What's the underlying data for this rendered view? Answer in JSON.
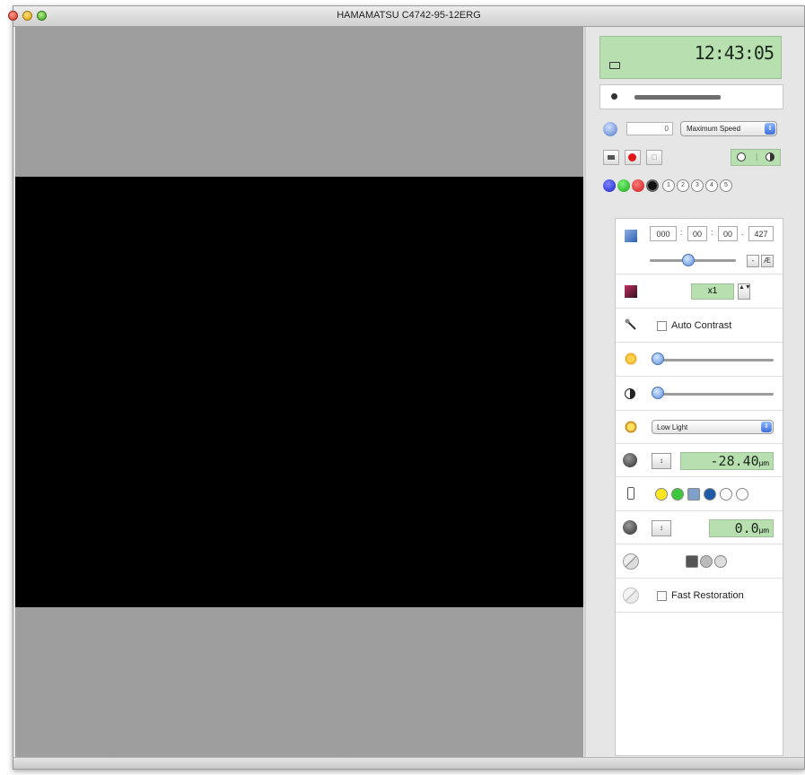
{
  "window": {
    "title": "HAMAMATSU C4742-95-12ERG"
  },
  "panel": {
    "clock": "12:43:05",
    "speed": {
      "value": "0",
      "mode": "Maximum Speed"
    },
    "channels": [
      "1",
      "2",
      "3",
      "4",
      "5"
    ],
    "time": {
      "h": "000",
      "m": "00",
      "s": "00",
      "ms": "427"
    },
    "zoom": "x1",
    "auto_contrast": "Auto Contrast",
    "light_mode": "Low Light",
    "z_position": "-28.40",
    "z_unit": "µm",
    "filters": [
      "1",
      "2",
      "3",
      "4",
      "5",
      "6"
    ],
    "offset": "0.0",
    "offset_unit": "µm",
    "fast_restoration": "Fast Restoration"
  }
}
